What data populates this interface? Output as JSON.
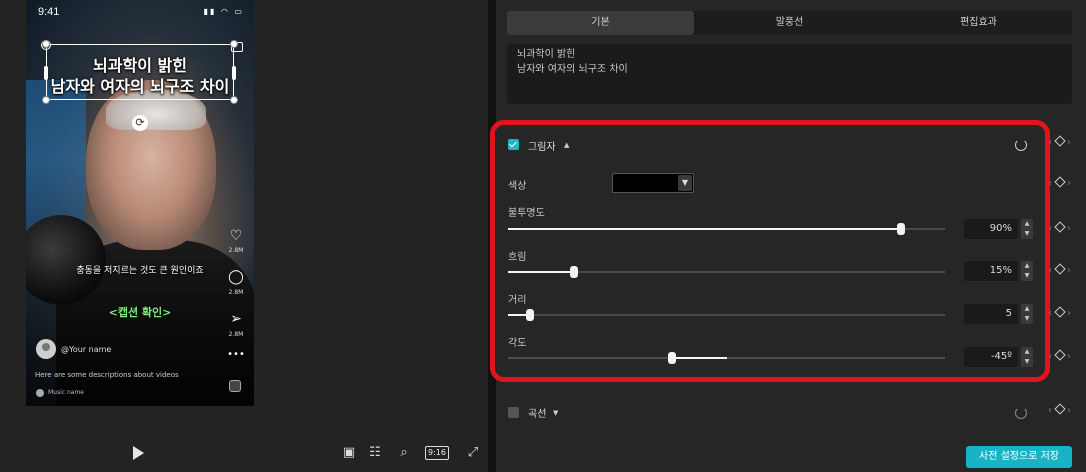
{
  "preview": {
    "status_time": "9:41",
    "status_icons": "▮▮ ◠ ▭",
    "title_line1": "뇌과학이 밝힌",
    "title_line2": "남자와 여자의 뇌구조 차이",
    "subtitle": "충동을 저지르는 것도 큰 원인이죠",
    "caption_check": "<캡션 확인>",
    "side_counts": [
      "2.8M",
      "2.8M",
      "2.8M"
    ],
    "username": "@Your name",
    "description": "Here are some descriptions about videos",
    "music_name": "Music name",
    "ratio": "9:16"
  },
  "inspector": {
    "tabs": [
      {
        "label": "기본"
      },
      {
        "label": "말풍선"
      },
      {
        "label": "편집효과"
      }
    ],
    "text_content": "뇌과학이 밝힌\n남자와 여자의 뇌구조 차이",
    "shadow": {
      "title": "그림자",
      "enabled": true,
      "color_label": "색상",
      "color_value": "#000000",
      "opacity": {
        "label": "불투명도",
        "value": 90,
        "display": "90%"
      },
      "blur": {
        "label": "흐림",
        "value": 15,
        "display": "15%"
      },
      "distance": {
        "label": "거리",
        "value": 5,
        "display": "5"
      },
      "angle": {
        "label": "각도",
        "value": -45,
        "display": "-45º"
      }
    },
    "curve": {
      "title": "곡선",
      "enabled": false
    },
    "preset_button": "사전 설정으로 저장"
  },
  "colors": {
    "accent": "#1fb6c8",
    "highlight": "#e0141c",
    "caption_green": "#7ef07a"
  }
}
